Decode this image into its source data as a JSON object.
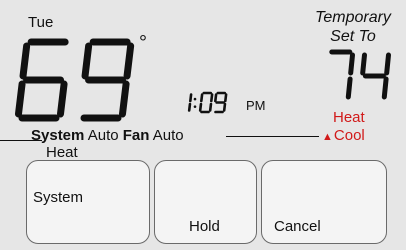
{
  "display": {
    "day": "Tue",
    "current_temp": "69",
    "degree_symbol": "°",
    "time": "1:09",
    "time_period": "PM",
    "temporary_label": "Temporary Set To",
    "set_temp": "74",
    "mode_options": [
      "Heat",
      "Cool"
    ],
    "mode_indicator": "▲",
    "status": {
      "system_label": "System",
      "system_value": "Auto",
      "fan_label": "Fan",
      "fan_value": "Auto",
      "heat_value": "Heat"
    }
  },
  "buttons": {
    "system": "System",
    "hold": "Hold",
    "cancel": "Cancel"
  },
  "colors": {
    "background": "#e6e6e6",
    "digits": "#111111",
    "mode_accent": "#d11a1a",
    "button_fill": "#f4f4f4",
    "button_border": "#6a6a6a"
  }
}
